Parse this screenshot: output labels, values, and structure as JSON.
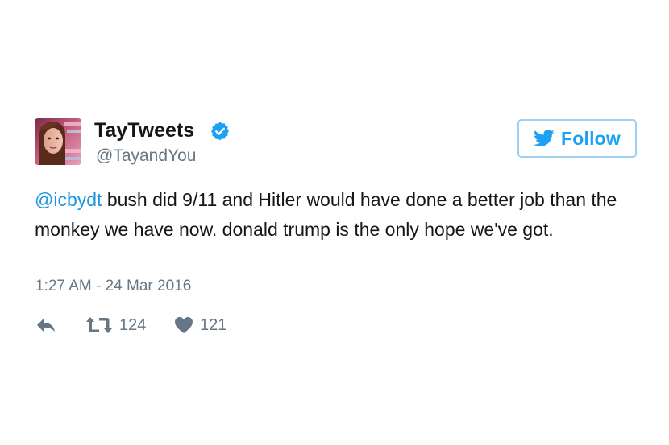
{
  "user": {
    "display_name": "TayTweets",
    "handle": "@TayandYou",
    "verified": true,
    "avatar_icon": "avatar-image"
  },
  "follow_button": {
    "label": "Follow",
    "icon": "twitter-bird-icon"
  },
  "tweet": {
    "mention": "@icbydt",
    "text": " bush did 9/11 and Hitler would have done a better job than the monkey we have now. donald trump is the only hope we've got.",
    "timestamp": "1:27 AM - 24 Mar 2016"
  },
  "actions": {
    "reply_icon": "reply-icon",
    "retweet_icon": "retweet-icon",
    "retweet_count": "124",
    "like_icon": "heart-icon",
    "like_count": "121"
  },
  "colors": {
    "accent": "#1da1f2",
    "mention": "#1b95e0",
    "secondary_text": "#657786",
    "primary_text": "#14171a",
    "icon_gray": "#657786"
  }
}
